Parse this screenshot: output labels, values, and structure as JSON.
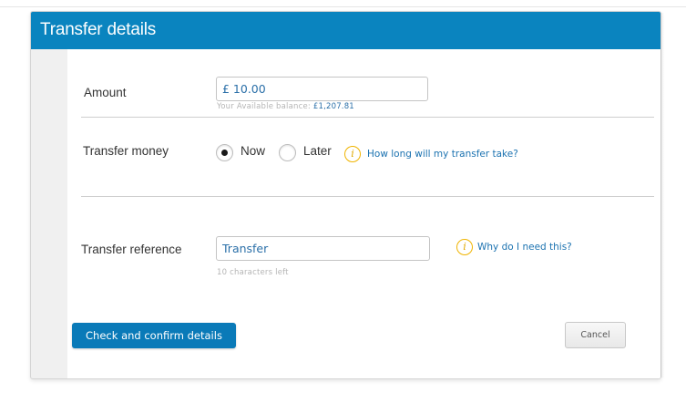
{
  "panel": {
    "title": "Transfer details"
  },
  "amount": {
    "label": "Amount",
    "value": "£ 10.00",
    "balance_prefix": "Your Available balance: ",
    "balance_value": "£1,207.81"
  },
  "transfer_money": {
    "label": "Transfer money",
    "options": [
      {
        "label": "Now",
        "selected": true
      },
      {
        "label": "Later",
        "selected": false
      }
    ],
    "info_icon": "info-icon",
    "help_link": "How long will my transfer take?"
  },
  "reference": {
    "label": "Transfer reference",
    "value": "Transfer",
    "chars_left": "10 characters left",
    "info_icon": "info-icon",
    "help_link": "Why do I need this?"
  },
  "actions": {
    "confirm_label": "Check and confirm details",
    "cancel_label": "Cancel"
  },
  "colors": {
    "header": "#0a84bf",
    "primary_button": "#0a7ab8",
    "link": "#1b72b0",
    "info_icon": "#f0b400"
  }
}
